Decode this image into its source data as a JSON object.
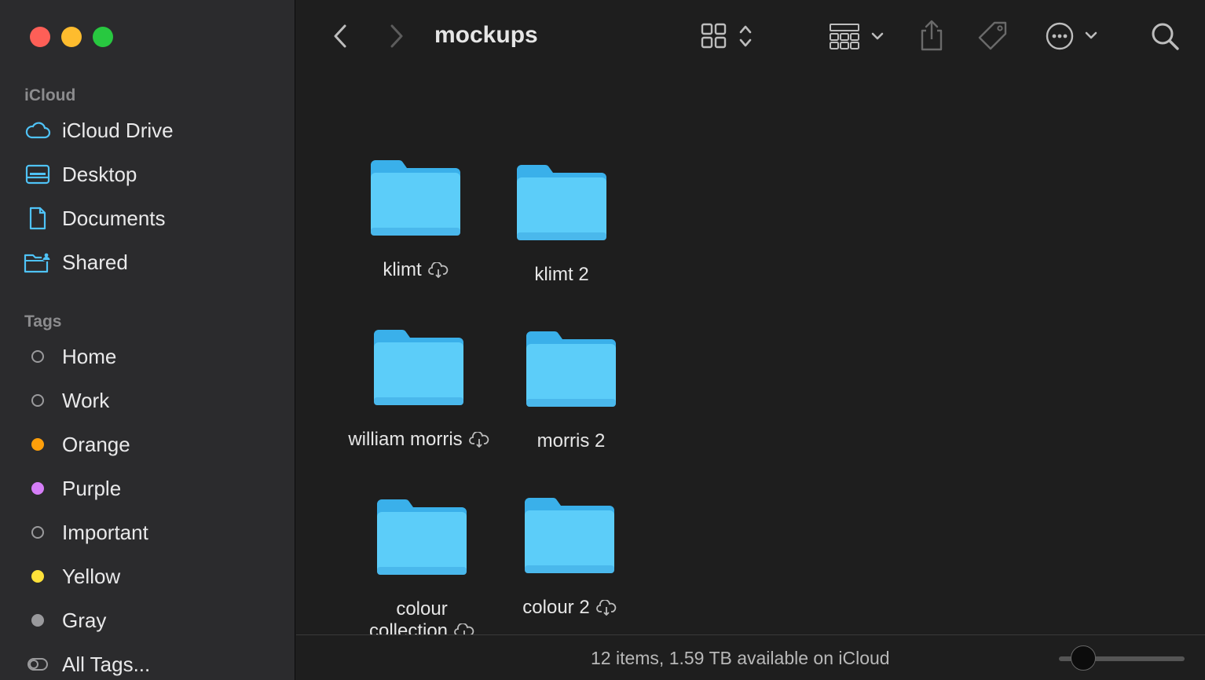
{
  "window": {
    "title": "mockups"
  },
  "sidebar": {
    "icloud_section": "iCloud",
    "icloud_items": [
      {
        "label": "iCloud Drive",
        "icon": "cloud-icon"
      },
      {
        "label": "Desktop",
        "icon": "desktop-icon"
      },
      {
        "label": "Documents",
        "icon": "document-icon"
      },
      {
        "label": "Shared",
        "icon": "shared-folder-icon"
      }
    ],
    "tags_section": "Tags",
    "tags": [
      {
        "label": "Home",
        "color": ""
      },
      {
        "label": "Work",
        "color": ""
      },
      {
        "label": "Orange",
        "color": "#fe9f0a"
      },
      {
        "label": "Purple",
        "color": "#d57ef7"
      },
      {
        "label": "Important",
        "color": ""
      },
      {
        "label": "Yellow",
        "color": "#fee13a"
      },
      {
        "label": "Gray",
        "color": "#99999c"
      },
      {
        "label": "All Tags...",
        "color": ""
      }
    ]
  },
  "toolbar": {
    "back": "chevron-left-icon",
    "forward": "chevron-right-icon",
    "view": "grid-view-icon",
    "group": "group-icon",
    "share": "share-icon",
    "tag": "tag-icon",
    "more": "ellipsis-circle-icon",
    "search": "search-icon"
  },
  "folders": [
    {
      "name": "klimt",
      "cloud": true
    },
    {
      "name": "klimt 2",
      "cloud": false
    },
    {
      "name": "william morris",
      "cloud": true
    },
    {
      "name": "morris 2",
      "cloud": false
    },
    {
      "name_line1": "colour",
      "name_line2": "collection",
      "cloud": true
    },
    {
      "name": "colour 2",
      "cloud": true
    }
  ],
  "status": {
    "text": "12 items, 1.59 TB available on iCloud"
  },
  "colors": {
    "folder": "#5ccdf9",
    "accent": "#4fc3f7"
  }
}
